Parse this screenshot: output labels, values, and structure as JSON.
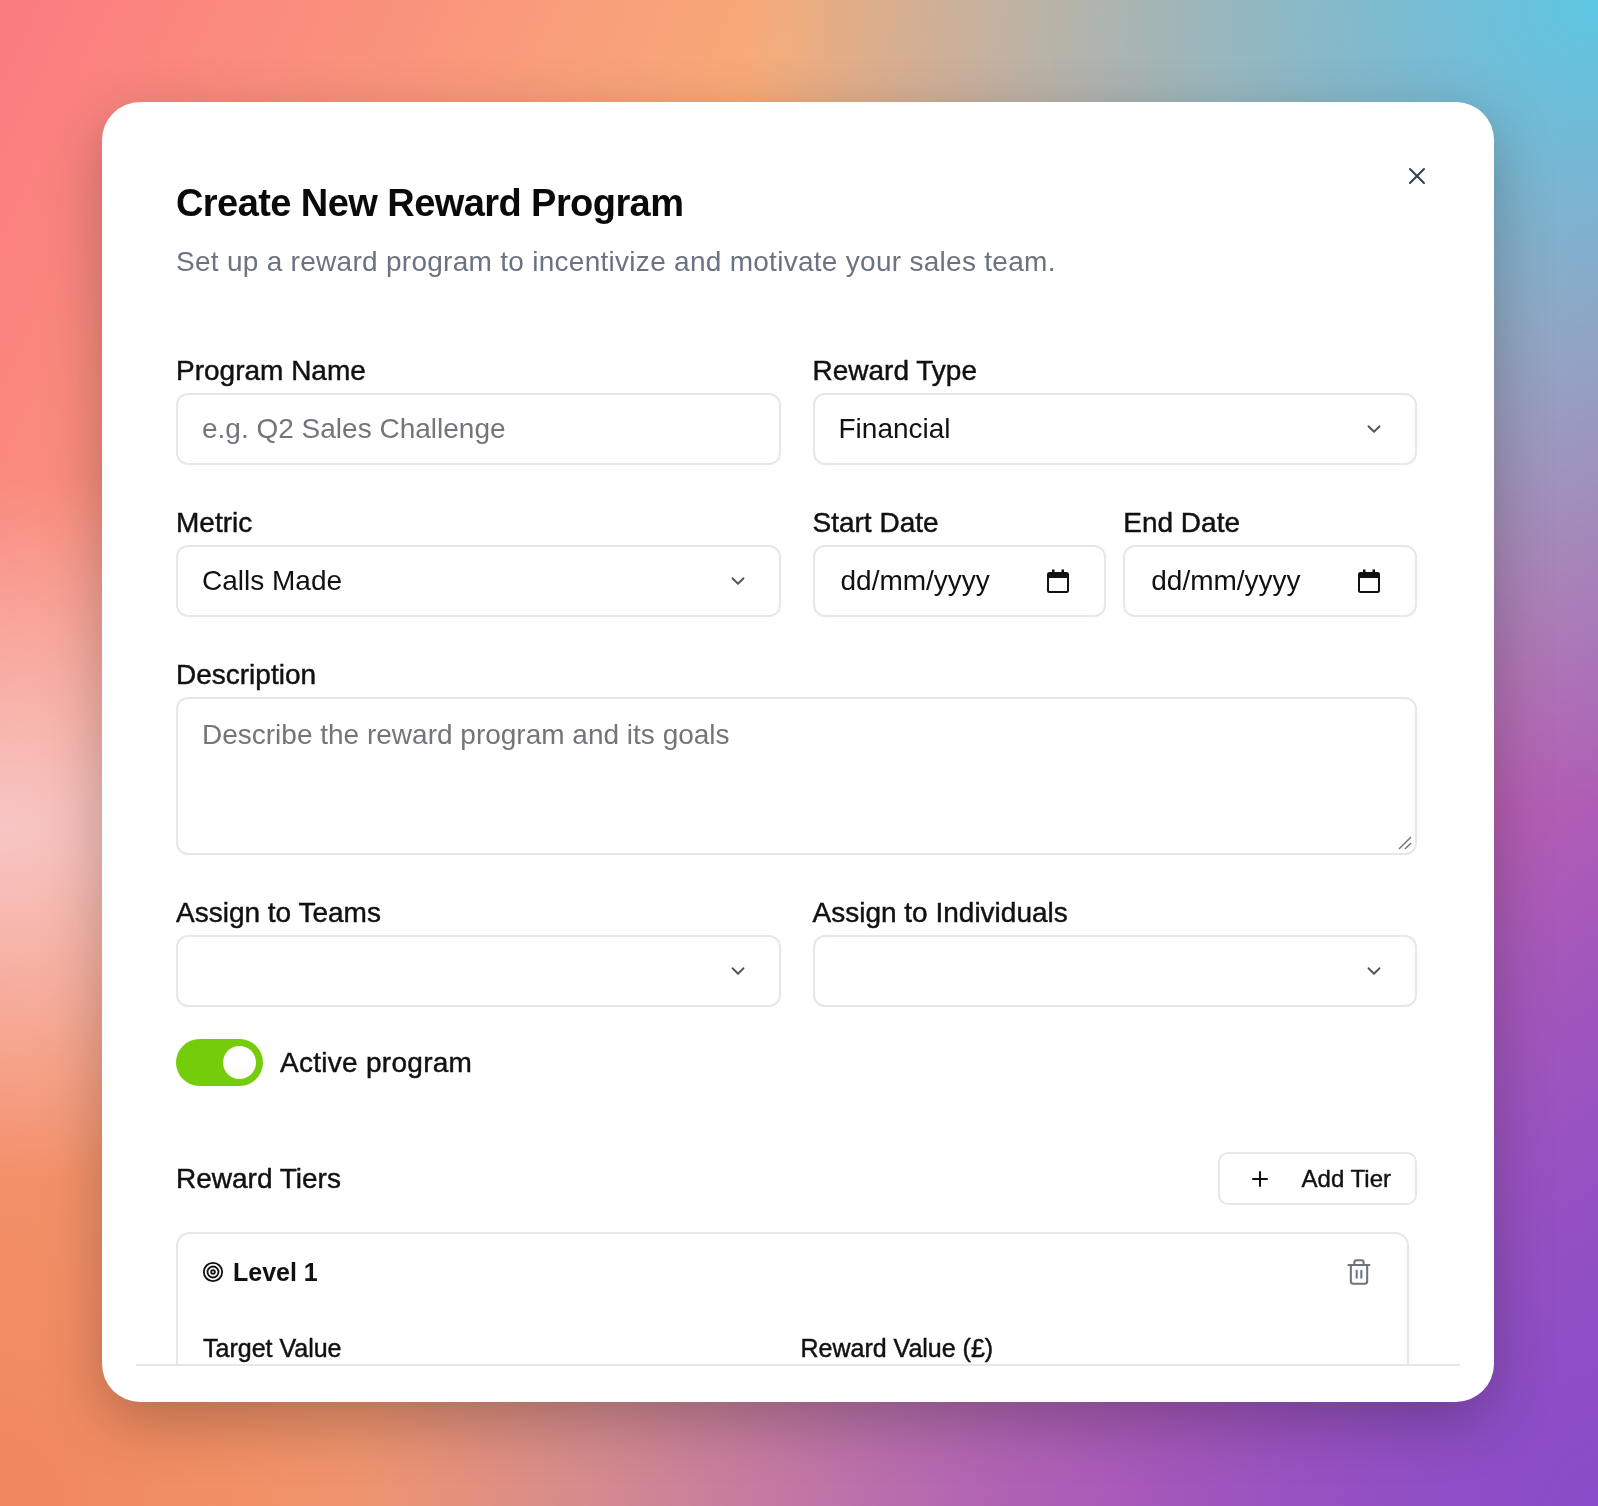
{
  "dialog": {
    "title": "Create New Reward Program",
    "subtitle": "Set up a reward program to incentivize and motivate your sales team."
  },
  "form_rows": [
    {
      "fields": [
        {
          "kind": "text",
          "label": "Program Name",
          "placeholder": "e.g. Q2 Sales Challenge"
        },
        {
          "kind": "select",
          "label": "Reward Type",
          "value": "Financial"
        }
      ]
    },
    {
      "fields": [
        {
          "kind": "select",
          "label": "Metric",
          "value": "Calls Made"
        },
        {
          "kind": "date",
          "label": "Start Date",
          "placeholder": "dd/mm/yyyy"
        },
        {
          "kind": "date",
          "label": "End Date",
          "placeholder": "dd/mm/yyyy"
        }
      ]
    },
    {
      "fields": [
        {
          "kind": "textarea",
          "label": "Description",
          "placeholder": "Describe the reward program and its goals"
        }
      ]
    },
    {
      "fields": [
        {
          "kind": "select",
          "label": "Assign to Teams"
        },
        {
          "kind": "select",
          "label": "Assign to Individuals"
        }
      ]
    }
  ],
  "active_toggle": {
    "label": "Active program",
    "on": true
  },
  "reward_tiers": {
    "title": "Reward Tiers",
    "add_button": "Add Tier",
    "tiers": [
      {
        "name": "Level 1",
        "field_labels": [
          "Target Value",
          "Reward Value (£)"
        ]
      }
    ]
  }
}
